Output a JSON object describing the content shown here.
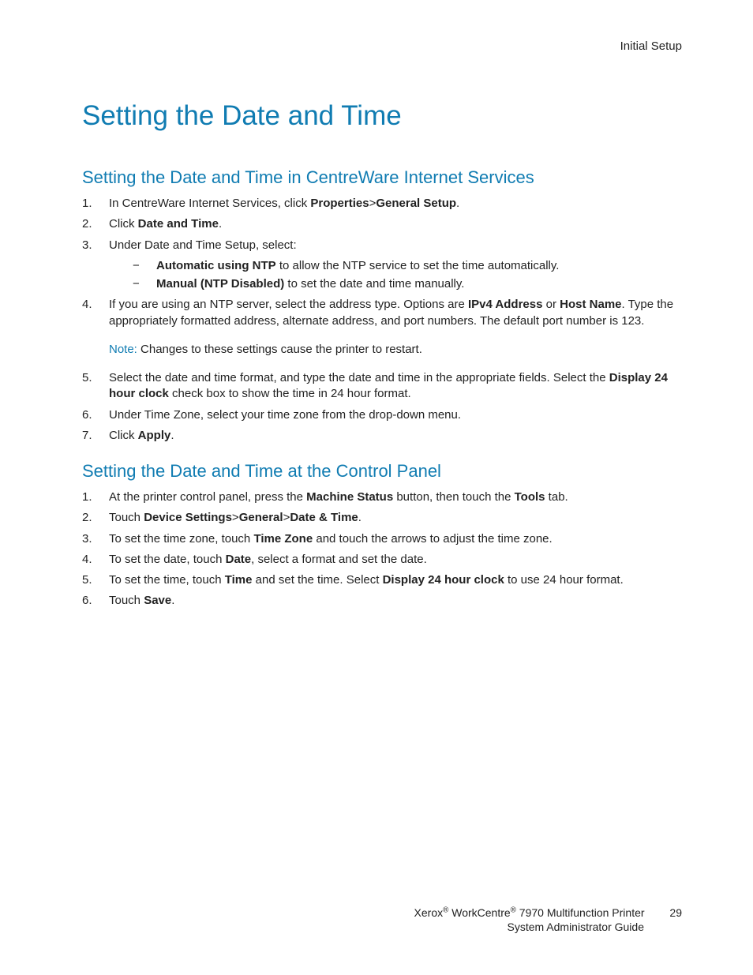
{
  "header": {
    "section": "Initial Setup"
  },
  "title": "Setting the Date and Time",
  "section1": {
    "heading": "Setting the Date and Time in CentreWare Internet Services",
    "steps": {
      "s1a": "In CentreWare Internet Services, click ",
      "s1b": "Properties",
      "s1c": ">",
      "s1d": "General Setup",
      "s1e": ".",
      "s2a": "Click ",
      "s2b": "Date and Time",
      "s2c": ".",
      "s3": "Under Date and Time Setup, select:",
      "s3sub1a": "Automatic using NTP",
      "s3sub1b": " to allow the NTP service to set the time automatically.",
      "s3sub2a": "Manual (NTP Disabled)",
      "s3sub2b": " to set the date and time manually.",
      "s4a": "If you are using an NTP server, select the address type. Options are ",
      "s4b": "IPv4 Address",
      "s4c": " or ",
      "s4d": "Host Name",
      "s4e": ". Type the appropriately formatted address, alternate address, and port numbers. The default port number is 123.",
      "note_label": "Note:",
      "note_body": " Changes to these settings cause the printer to restart.",
      "s5a": "Select the date and time format, and type the date and time in the appropriate fields. Select the ",
      "s5b": "Display 24 hour clock",
      "s5c": " check box to show the time in 24 hour format.",
      "s6": "Under Time Zone, select your time zone from the drop-down menu.",
      "s7a": "Click ",
      "s7b": "Apply",
      "s7c": "."
    }
  },
  "section2": {
    "heading": "Setting the Date and Time at the Control Panel",
    "steps": {
      "s1a": "At the printer control panel, press the ",
      "s1b": "Machine Status",
      "s1c": " button, then touch the ",
      "s1d": "Tools",
      "s1e": " tab.",
      "s2a": "Touch ",
      "s2b": "Device Settings",
      "s2c": ">",
      "s2d": "General",
      "s2e": ">",
      "s2f": "Date & Time",
      "s2g": ".",
      "s3a": "To set the time zone, touch ",
      "s3b": "Time Zone",
      "s3c": " and touch the arrows to adjust the time zone.",
      "s4a": "To set the date, touch ",
      "s4b": "Date",
      "s4c": ", select a format and set the date.",
      "s5a": "To set the time, touch ",
      "s5b": "Time",
      "s5c": " and set the time. Select ",
      "s5d": "Display 24 hour clock",
      "s5e": " to use 24 hour format.",
      "s6a": "Touch ",
      "s6b": "Save",
      "s6c": "."
    }
  },
  "footer": {
    "line1_a": "Xerox",
    "line1_b": " WorkCentre",
    "line1_c": " 7970 Multifunction Printer",
    "line2": "System Administrator Guide",
    "page": "29"
  }
}
